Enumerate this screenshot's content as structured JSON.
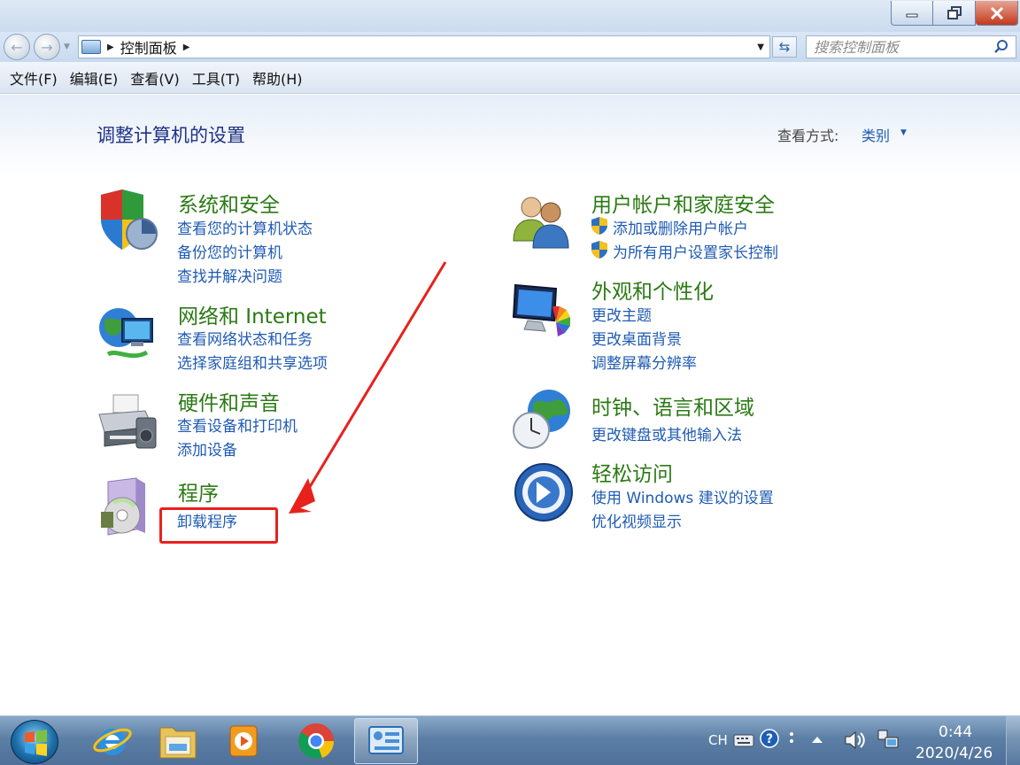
{
  "window": {
    "minimize_icon": "minimize-icon",
    "restore_icon": "restore-icon",
    "close_icon": "close-icon"
  },
  "address": {
    "breadcrumb": "控制面板",
    "search_placeholder": "搜索控制面板"
  },
  "menu": {
    "file": "文件(F)",
    "edit": "编辑(E)",
    "view": "查看(V)",
    "tools": "工具(T)",
    "help": "帮助(H)"
  },
  "main": {
    "title": "调整计算机的设置",
    "view_by_label": "查看方式:",
    "view_by_value": "类别"
  },
  "categories": {
    "system_security": {
      "title": "系统和安全",
      "links": [
        "查看您的计算机状态",
        "备份您的计算机",
        "查找并解决问题"
      ]
    },
    "network": {
      "title": "网络和 Internet",
      "links": [
        "查看网络状态和任务",
        "选择家庭组和共享选项"
      ]
    },
    "hardware": {
      "title": "硬件和声音",
      "links": [
        "查看设备和打印机",
        "添加设备"
      ]
    },
    "programs": {
      "title": "程序",
      "links": [
        "卸载程序"
      ]
    },
    "user_accounts": {
      "title": "用户帐户和家庭安全",
      "links": [
        "添加或删除用户帐户",
        "为所有用户设置家长控制"
      ]
    },
    "appearance": {
      "title": "外观和个性化",
      "links": [
        "更改主题",
        "更改桌面背景",
        "调整屏幕分辨率"
      ]
    },
    "clock": {
      "title": "时钟、语言和区域",
      "links": [
        "更改键盘或其他输入法"
      ]
    },
    "ease": {
      "title": "轻松访问",
      "links": [
        "使用 Windows 建议的设置",
        "优化视频显示"
      ]
    }
  },
  "taskbar": {
    "language": "CH",
    "time": "0:44",
    "date": "2020/4/26"
  },
  "colors": {
    "category_title": "#2b7a14",
    "link": "#1f5bb3",
    "page_title": "#1e3287",
    "annotation": "#e8211d"
  }
}
